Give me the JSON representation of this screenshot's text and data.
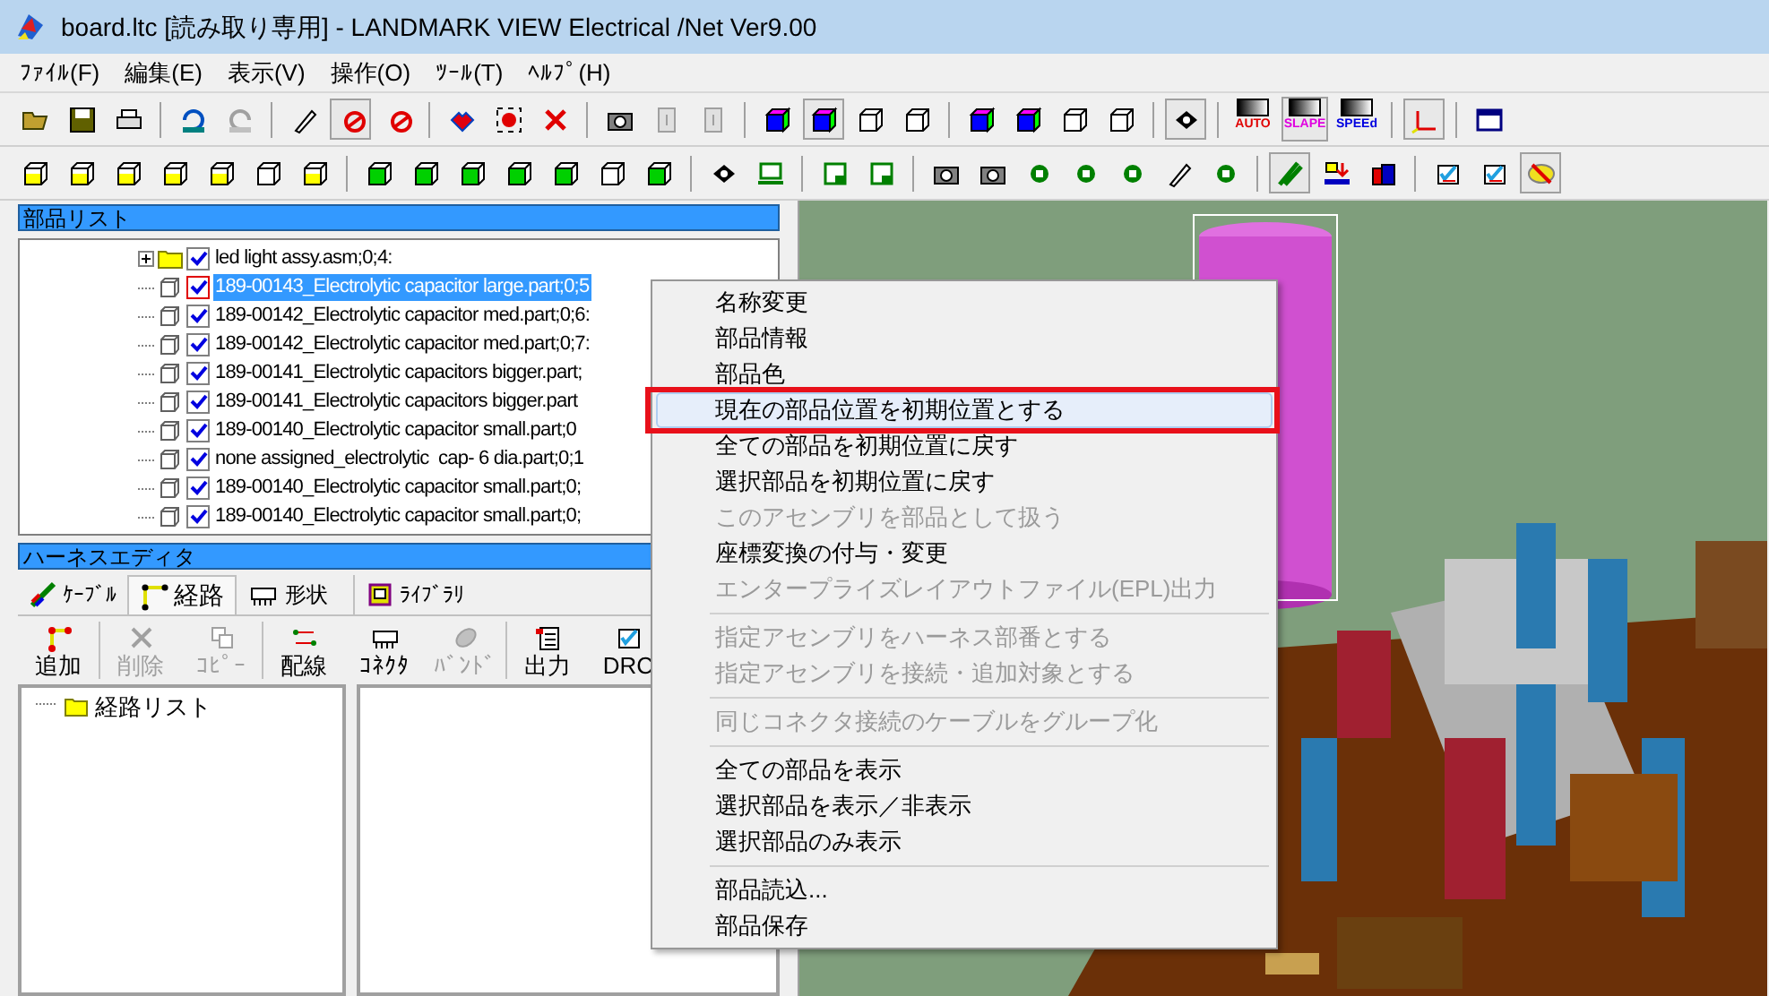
{
  "window": {
    "title": "board.ltc [読み取り専用] - LANDMARK VIEW Electrical /Net Ver9.00"
  },
  "menu_bar": [
    "ﾌｧｲﾙ(F)",
    "編集(E)",
    "表示(V)",
    "操作(O)",
    "ﾂｰﾙ(T)",
    "ﾍﾙﾌﾟ(H)"
  ],
  "toolbar": {
    "mode_buttons": [
      {
        "label": "AUTO",
        "selected": false
      },
      {
        "label": "SLAPE",
        "selected": true
      },
      {
        "label": "SPEEd",
        "selected": false
      }
    ]
  },
  "parts_list": {
    "title": "部品リスト",
    "items": [
      {
        "kind": "assembly",
        "label": "led light assy.asm;0;4:",
        "checked": true,
        "selected": false
      },
      {
        "kind": "part",
        "label": "189-00143_Electrolytic capacitor large.part;0;5",
        "checked": true,
        "selected": true
      },
      {
        "kind": "part",
        "label": "189-00142_Electrolytic capacitor med.part;0;6:",
        "checked": true,
        "selected": false
      },
      {
        "kind": "part",
        "label": "189-00142_Electrolytic capacitor med.part;0;7:",
        "checked": true,
        "selected": false
      },
      {
        "kind": "part",
        "label": "189-00141_Electrolytic capacitors bigger.part;",
        "checked": true,
        "selected": false
      },
      {
        "kind": "part",
        "label": "189-00141_Electrolytic capacitors bigger.part",
        "checked": true,
        "selected": false
      },
      {
        "kind": "part",
        "label": "189-00140_Electrolytic capacitor small.part;0",
        "checked": true,
        "selected": false
      },
      {
        "kind": "part",
        "label": "none assigned_electrolytic  cap- 6 dia.part;0;1",
        "checked": true,
        "selected": false
      },
      {
        "kind": "part",
        "label": "189-00140_Electrolytic capacitor small.part;0;",
        "checked": true,
        "selected": false
      },
      {
        "kind": "part",
        "label": "189-00140_Electrolytic capacitor small.part;0;",
        "checked": true,
        "selected": false
      }
    ]
  },
  "harness_editor": {
    "title": "ハーネスエディタ",
    "tabs": [
      {
        "label": "ｹｰﾌﾞﾙ",
        "selected": false
      },
      {
        "label": "経路",
        "selected": true
      },
      {
        "label": "形状",
        "selected": false
      },
      {
        "label": "ﾗｲﾌﾞﾗﾘ",
        "selected": false
      }
    ],
    "tools": [
      {
        "kind": "add",
        "label": "追加",
        "disabled": false
      },
      {
        "kind": "delete",
        "label": "削除",
        "disabled": true
      },
      {
        "kind": "copy",
        "label": "ｺﾋﾟｰ",
        "disabled": true
      },
      {
        "kind": "wire",
        "label": "配線",
        "disabled": false
      },
      {
        "kind": "connector",
        "label": "ｺﾈｸﾀ",
        "disabled": false
      },
      {
        "kind": "band",
        "label": "ﾊﾞﾝﾄﾞ",
        "disabled": true
      },
      {
        "kind": "output",
        "label": "出力",
        "disabled": false
      },
      {
        "kind": "drc",
        "label": "DRC",
        "disabled": false
      }
    ],
    "route_tree": {
      "label": "経路リスト"
    }
  },
  "context_menu": [
    {
      "kind": "item",
      "label": "名称変更",
      "disabled": false,
      "selected": false
    },
    {
      "kind": "item",
      "label": "部品情報",
      "disabled": false,
      "selected": false
    },
    {
      "kind": "item",
      "label": "部品色",
      "disabled": false,
      "selected": false
    },
    {
      "kind": "item",
      "label": "現在の部品位置を初期位置とする",
      "disabled": false,
      "selected": true,
      "emphasized": true
    },
    {
      "kind": "item",
      "label": "全ての部品を初期位置に戻す",
      "disabled": false,
      "selected": false
    },
    {
      "kind": "item",
      "label": "選択部品を初期位置に戻す",
      "disabled": false,
      "selected": false
    },
    {
      "kind": "item",
      "label": "このアセンブリを部品として扱う",
      "disabled": true,
      "selected": false
    },
    {
      "kind": "item",
      "label": "座標変換の付与・変更",
      "disabled": false,
      "selected": false
    },
    {
      "kind": "item",
      "label": "エンタープライズレイアウトファイル(EPL)出力",
      "disabled": true,
      "selected": false
    },
    {
      "kind": "separator"
    },
    {
      "kind": "item",
      "label": "指定アセンブリをハーネス部番とする",
      "disabled": true,
      "selected": false
    },
    {
      "kind": "item",
      "label": "指定アセンブリを接続・追加対象とする",
      "disabled": true,
      "selected": false
    },
    {
      "kind": "separator"
    },
    {
      "kind": "item",
      "label": "同じコネクタ接続のケーブルをグループ化",
      "disabled": true,
      "selected": false
    },
    {
      "kind": "separator"
    },
    {
      "kind": "item",
      "label": "全ての部品を表示",
      "disabled": false,
      "selected": false
    },
    {
      "kind": "item",
      "label": "選択部品を表示／非表示",
      "disabled": false,
      "selected": false
    },
    {
      "kind": "item",
      "label": "選択部品のみ表示",
      "disabled": false,
      "selected": false
    },
    {
      "kind": "separator"
    },
    {
      "kind": "item",
      "label": "部品読込...",
      "disabled": false,
      "selected": false
    },
    {
      "kind": "item",
      "label": "部品保存",
      "disabled": false,
      "selected": false
    }
  ]
}
